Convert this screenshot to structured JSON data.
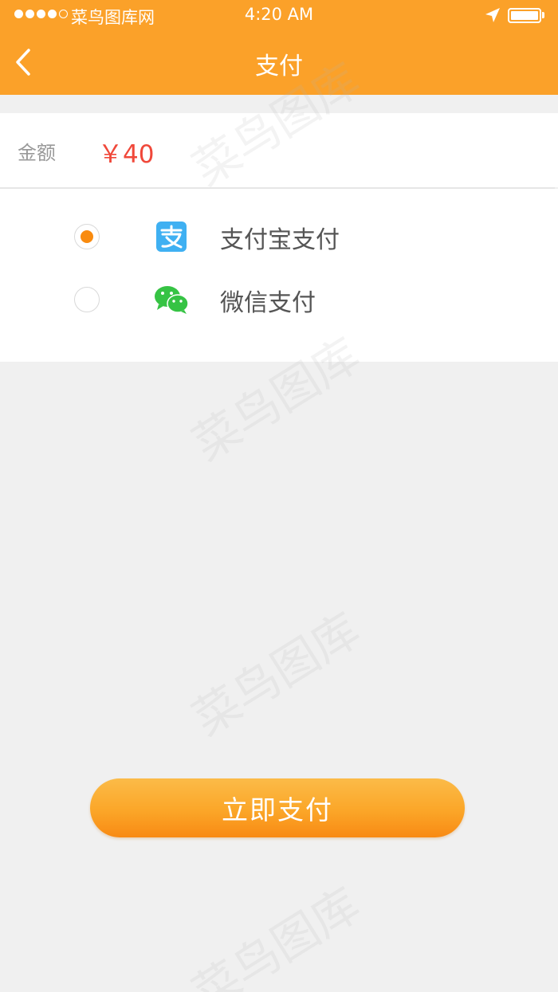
{
  "status_bar": {
    "carrier": "菜鸟图库网",
    "time": "4:20 AM",
    "signal_icon": "signal-dots-icon",
    "location_icon": "location-arrow-icon",
    "battery_icon": "battery-icon"
  },
  "nav": {
    "title": "支付",
    "back_icon": "chevron-left-icon"
  },
  "amount": {
    "label": "金额",
    "value": "￥40"
  },
  "payment_methods": [
    {
      "label": "支付宝支付",
      "icon": "alipay-icon",
      "selected": true
    },
    {
      "label": "微信支付",
      "icon": "wechat-icon",
      "selected": false
    }
  ],
  "pay_button": {
    "label": "立即支付"
  },
  "watermark": {
    "text": "菜鸟图库"
  },
  "colors": {
    "header": "#fba129",
    "accent": "#f98b0f",
    "amount": "#f0483a",
    "background": "#f0f0f0",
    "alipay_blue": "#3fb0f2",
    "wechat_green": "#36c344"
  }
}
